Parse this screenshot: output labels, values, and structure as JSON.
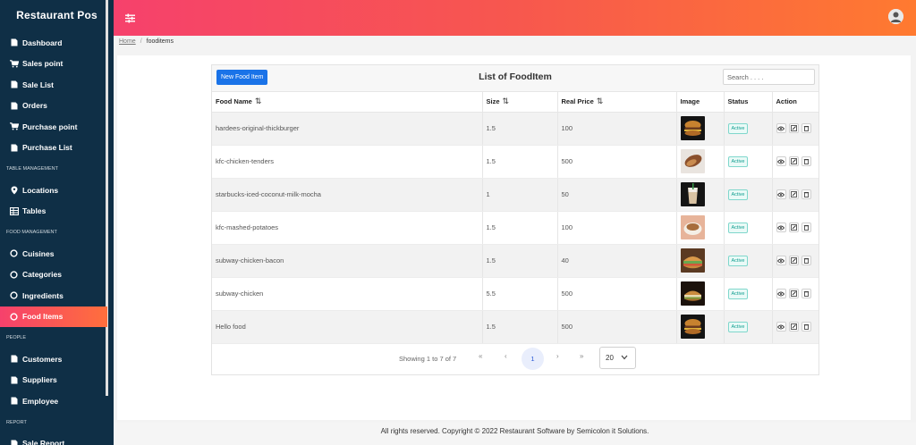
{
  "app": {
    "brand": "Restaurant Pos"
  },
  "sidebar": {
    "items": [
      {
        "label": "Dashboard",
        "icon": "doc-icon"
      },
      {
        "label": "Sales point",
        "icon": "cart-icon"
      },
      {
        "label": "Sale List",
        "icon": "doc-icon"
      },
      {
        "label": "Orders",
        "icon": "doc-icon"
      },
      {
        "label": "Purchase point",
        "icon": "cart-icon"
      },
      {
        "label": "Purchase List",
        "icon": "doc-icon"
      }
    ],
    "section_table": "TABLE MANAGEMENT",
    "table_items": [
      {
        "label": "Locations",
        "icon": "pin-icon"
      },
      {
        "label": "Tables",
        "icon": "table-icon"
      }
    ],
    "section_food": "FOOD MANAGEMENT",
    "food_items": [
      {
        "label": "Cuisines",
        "icon": "circle-icon"
      },
      {
        "label": "Categories",
        "icon": "circle-icon"
      },
      {
        "label": "Ingredients",
        "icon": "circle-icon"
      },
      {
        "label": "Food Items",
        "icon": "circle-icon",
        "active": true
      }
    ],
    "section_people": "PEOPLE",
    "people_items": [
      {
        "label": "Customers",
        "icon": "doc-icon"
      },
      {
        "label": "Suppliers",
        "icon": "doc-icon"
      },
      {
        "label": "Employee",
        "icon": "doc-icon"
      }
    ],
    "section_report": "REPORT",
    "report_items": [
      {
        "label": "Sale Report",
        "icon": "doc-icon"
      }
    ]
  },
  "breadcrumb": {
    "home": "Home",
    "current": "fooditems"
  },
  "card": {
    "new_button": "New Food Item",
    "title": "List of FoodItem",
    "search_placeholder": "Search . . . ."
  },
  "table": {
    "headers": {
      "name": "Food Name",
      "size": "Size",
      "price": "Real Price",
      "image": "Image",
      "status": "Status",
      "action": "Action"
    },
    "sort_glyph": "⇅",
    "rows": [
      {
        "name": "hardees-original-thickburger",
        "size": "1.5",
        "price": "100",
        "status": "Active",
        "thumb": "burger-dark"
      },
      {
        "name": "kfc-chicken-tenders",
        "size": "1.5",
        "price": "500",
        "status": "Active",
        "thumb": "tenders"
      },
      {
        "name": "starbucks-iced-coconut-milk-mocha",
        "size": "1",
        "price": "50",
        "status": "Active",
        "thumb": "drink"
      },
      {
        "name": "kfc-mashed-potatoes",
        "size": "1.5",
        "price": "100",
        "status": "Active",
        "thumb": "potatoes"
      },
      {
        "name": "subway-chicken-bacon",
        "size": "1.5",
        "price": "40",
        "status": "Active",
        "thumb": "sandwich"
      },
      {
        "name": "subway-chicken",
        "size": "5.5",
        "price": "500",
        "status": "Active",
        "thumb": "sandwich-dark"
      },
      {
        "name": "Hello food",
        "size": "1.5",
        "price": "500",
        "status": "Active",
        "thumb": "burger-dark"
      }
    ]
  },
  "pager": {
    "showing": "Showing 1 to 7 of 7",
    "first": "«",
    "prev": "‹",
    "current": "1",
    "next": "›",
    "last": "»",
    "per_page": "20"
  },
  "footer": {
    "text": "All rights reserved. Copyright © 2022 Restaurant Software by Semicolon it Solutions."
  },
  "colors": {
    "accent_start": "#f6416c",
    "accent_end": "#ff7a30",
    "sidebar": "#0f2f46",
    "primary_button": "#1a73e8",
    "active_badge": "#0f9d8f"
  }
}
